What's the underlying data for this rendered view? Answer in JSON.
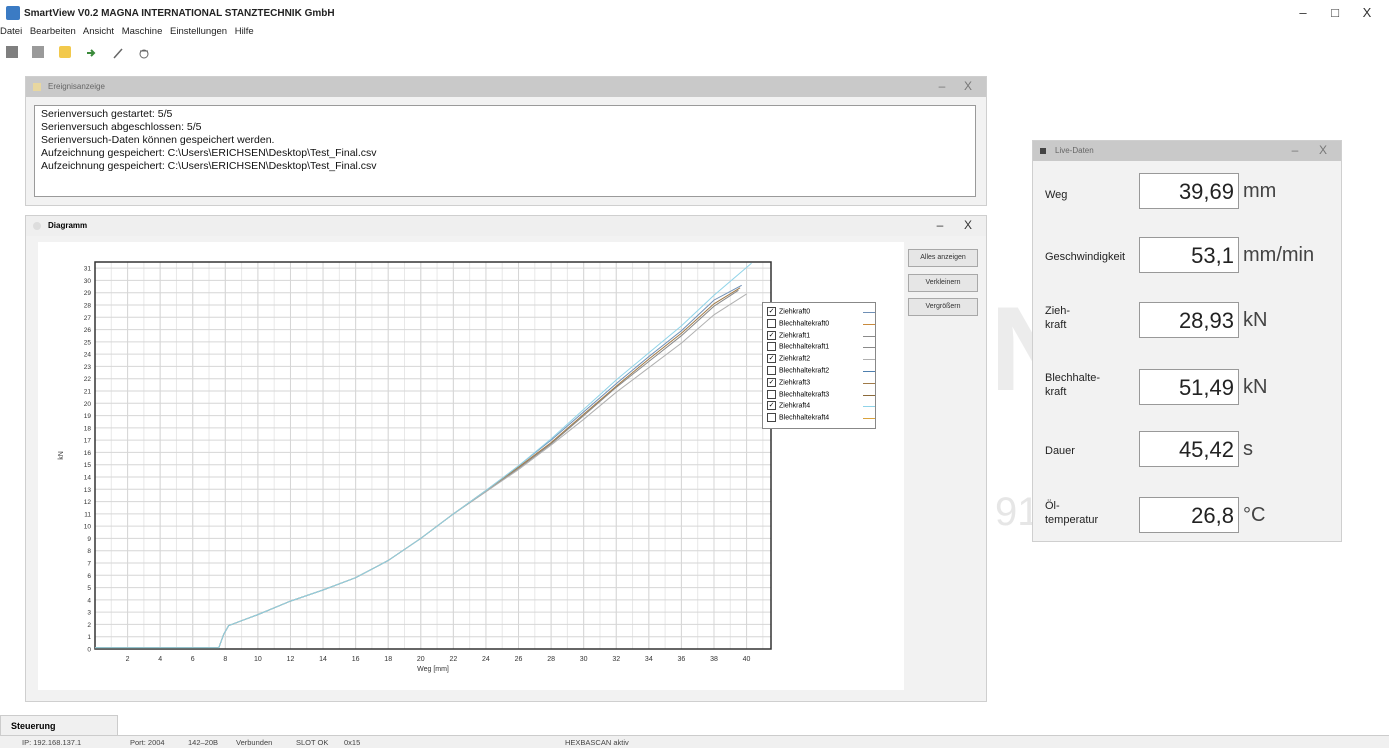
{
  "app": {
    "title": "SmartView V0.2 MAGNA INTERNATIONAL STANZTECHNIK GmbH"
  },
  "window_controls": {
    "minimize": "–",
    "maximize": "□",
    "close": "X"
  },
  "menu": [
    "Datei",
    "Bearbeiten",
    "Ansicht",
    "Maschine",
    "Einstellungen",
    "Hilfe"
  ],
  "toolbar": [
    {
      "icon": "stop-icon"
    },
    {
      "icon": "record-icon"
    },
    {
      "icon": "folder-open-icon"
    },
    {
      "icon": "arrow-right-icon"
    },
    {
      "icon": "pen-icon"
    },
    {
      "icon": "calibrate-icon"
    }
  ],
  "event_panel": {
    "title": "Ereignisanzeige",
    "lines": [
      "Serienversuch gestartet: 5/5",
      "Serienversuch abgeschlossen: 5/5",
      "Serienversuch-Daten können gespeichert werden.",
      "Aufzeichnung gespeichert: C:\\Users\\ERICHSEN\\Desktop\\Test_Final.csv",
      "Aufzeichnung gespeichert: C:\\Users\\ERICHSEN\\Desktop\\Test_Final.csv"
    ]
  },
  "diagram_panel": {
    "title": "Diagramm",
    "buttons": {
      "show_all": "Alles anzeigen",
      "zoom_out": "Verkleinern",
      "zoom_in": "Vergrößern"
    }
  },
  "chart_data": {
    "type": "line",
    "xlabel": "Weg [mm]",
    "ylabel": "kN",
    "xlim": [
      0,
      41.5
    ],
    "ylim": [
      0,
      31.5
    ],
    "xticks": [
      2,
      4,
      6,
      8,
      10,
      12,
      14,
      16,
      18,
      20,
      22,
      24,
      26,
      28,
      30,
      32,
      34,
      36,
      38,
      40
    ],
    "yticks": [
      0,
      1,
      2,
      3,
      4,
      5,
      6,
      7,
      8,
      9,
      10,
      11,
      12,
      13,
      14,
      15,
      16,
      17,
      18,
      19,
      20,
      21,
      22,
      23,
      24,
      25,
      26,
      27,
      28,
      29,
      30,
      31
    ],
    "grid": true,
    "legend_position": "right",
    "series": [
      {
        "name": "Ziehkraft0",
        "checked": true,
        "color": "#6f8fb5",
        "x": [
          0,
          7.6,
          7.9,
          8.2,
          9,
          10,
          12,
          14,
          16,
          18,
          20,
          22,
          24,
          26,
          28,
          30,
          32,
          34,
          36,
          38,
          39.7
        ],
        "y": [
          0.1,
          0.1,
          1.2,
          1.9,
          2.3,
          2.8,
          3.9,
          4.8,
          5.8,
          7.2,
          9,
          11,
          12.9,
          14.9,
          17,
          19.3,
          21.6,
          23.8,
          25.9,
          28.4,
          29.6
        ]
      },
      {
        "name": "Blechhaltekraft0",
        "checked": false,
        "color": "#c98a3c",
        "x": [],
        "y": []
      },
      {
        "name": "Ziehkraft1",
        "checked": true,
        "color": "#8a8a8a",
        "x": [
          0,
          7.6,
          7.9,
          8.2,
          9,
          10,
          12,
          14,
          16,
          18,
          20,
          22,
          24,
          26,
          28,
          30,
          32,
          34,
          36,
          38,
          39.5
        ],
        "y": [
          0.1,
          0.1,
          1.2,
          1.9,
          2.3,
          2.8,
          3.9,
          4.8,
          5.8,
          7.2,
          9,
          11,
          12.8,
          14.7,
          16.7,
          19,
          21.3,
          23.4,
          25.5,
          27.9,
          29.2
        ]
      },
      {
        "name": "Blechhaltekraft1",
        "checked": false,
        "color": "#8a8a8a",
        "x": [],
        "y": []
      },
      {
        "name": "Ziehkraft2",
        "checked": true,
        "color": "#b0b0b0",
        "x": [
          0,
          7.6,
          7.9,
          8.2,
          9,
          10,
          12,
          14,
          16,
          18,
          20,
          22,
          24,
          26,
          28,
          30,
          32,
          34,
          36,
          38,
          40
        ],
        "y": [
          0.1,
          0.1,
          1.2,
          1.9,
          2.3,
          2.8,
          3.9,
          4.8,
          5.8,
          7.2,
          9,
          11,
          12.8,
          14.6,
          16.6,
          18.7,
          20.9,
          22.9,
          24.9,
          27.2,
          28.9
        ]
      },
      {
        "name": "Blechhaltekraft2",
        "checked": false,
        "color": "#4e7fae",
        "x": [],
        "y": []
      },
      {
        "name": "Ziehkraft3",
        "checked": true,
        "color": "#a07a48",
        "x": [
          0,
          7.6,
          7.9,
          8.2,
          9,
          10,
          12,
          14,
          16,
          18,
          20,
          22,
          24,
          26,
          28,
          30,
          32,
          34,
          36,
          38,
          39.6
        ],
        "y": [
          0.1,
          0.1,
          1.2,
          1.9,
          2.3,
          2.8,
          3.9,
          4.8,
          5.8,
          7.2,
          9,
          11,
          12.9,
          14.8,
          16.8,
          19.1,
          21.4,
          23.6,
          25.7,
          28.1,
          29.4
        ]
      },
      {
        "name": "Blechhaltekraft3",
        "checked": false,
        "color": "#8c6a3a",
        "x": [],
        "y": []
      },
      {
        "name": "Ziehkraft4",
        "checked": true,
        "color": "#8fd3e8",
        "x": [
          0,
          7.6,
          7.9,
          8.2,
          9,
          10,
          12,
          14,
          16,
          18,
          20,
          22,
          24,
          26,
          28,
          30,
          32,
          34,
          36,
          38,
          40.3
        ],
        "y": [
          0.1,
          0.1,
          1.2,
          1.9,
          2.3,
          2.8,
          3.9,
          4.8,
          5.8,
          7.2,
          9,
          11,
          12.9,
          14.9,
          17.1,
          19.5,
          21.9,
          24.1,
          26.3,
          28.8,
          31.4
        ]
      },
      {
        "name": "Blechhaltekraft4",
        "checked": false,
        "color": "#d9a23c",
        "x": [],
        "y": []
      }
    ]
  },
  "live_panel": {
    "title": "Live-Daten",
    "rows": [
      {
        "label": "Weg",
        "value": "39,69",
        "unit": "mm"
      },
      {
        "label": "Geschwindigkeit",
        "value": "53,1",
        "unit": "mm/min"
      },
      {
        "label": "Zieh-\nkraft",
        "value": "28,93",
        "unit": "kN"
      },
      {
        "label": "Blechhalte-\nkraft",
        "value": "51,49",
        "unit": "kN"
      },
      {
        "label": "Dauer",
        "value": "45,42",
        "unit": "s"
      },
      {
        "label": "Öl-\ntemperatur",
        "value": "26,8",
        "unit": "°C"
      }
    ]
  },
  "bottom_tab": "Steuerung",
  "statusbar": [
    "IP: 192.168.137.1",
    "Port: 2004",
    "142–20B",
    "Verbunden",
    "SLOT OK",
    "0x15",
    "HEXBASCAN aktiv"
  ]
}
